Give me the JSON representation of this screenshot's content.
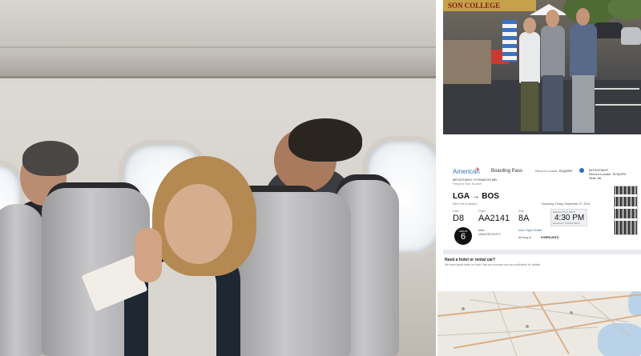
{
  "campus_photo": {
    "sign_text": "SON COLLEGE"
  },
  "boarding_pass": {
    "airline": "American",
    "title": "Boarding Pass",
    "record_locator_label": "Record Locator:",
    "record_locator": "SVQGRV",
    "passenger_names": "MITSOTAKIS / KYRIAKOS MR",
    "passenger_sub": "Frequent Flyer Number",
    "right_name_line1": "MITSOTAKIS",
    "right_name_line2": "Record Locator: SVQGRV",
    "right_name_line3": "Seat: 8A",
    "route": "LGA → BOS",
    "cities": "New York to Boston",
    "departing": "Departing: Friday, September 27, 2019",
    "gate_label": "Gate",
    "gate": "D8",
    "flight_label": "Flight",
    "flight": "AA2141",
    "seat_label": "Seat",
    "seat": "8A",
    "boarding_label": "Boarding Time (EDT)",
    "boarding_time": "4:30 PM",
    "boarding_sub": "Departure: 5:05PM (EDT)",
    "group_label": "GROUP",
    "group": "6",
    "class_label": "Main",
    "class_value": "UNAVENTIONTO",
    "more_details": "More Flight Details",
    "arriving_label": "Arriving at",
    "arriving_time": "6:05PM (EDT)",
    "rental_heading": "Need a hotel or rental car?",
    "rental_sub": "We have great deals on both! Visit aa.com/cars and aa.com/hotels for details."
  },
  "colors": {
    "american_blue": "#3a6fb2",
    "american_red": "#c92a2a",
    "seat_dark": "#2b2b2d",
    "map_bg": "#ece9e2"
  }
}
